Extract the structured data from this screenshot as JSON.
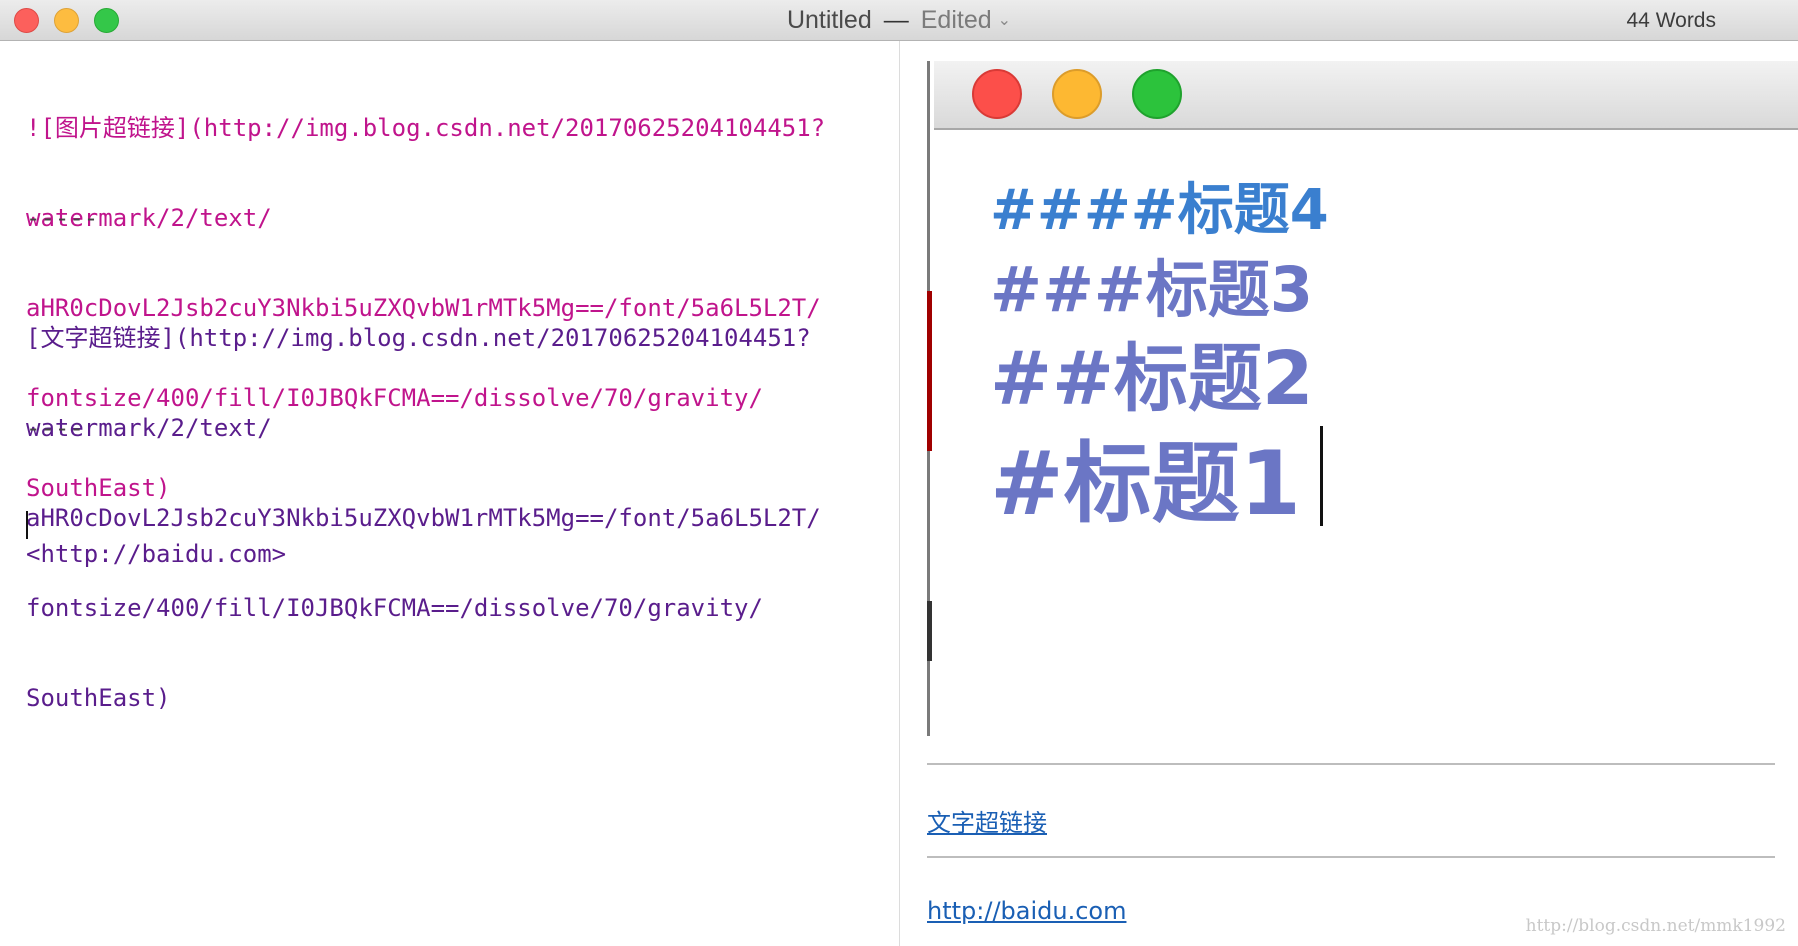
{
  "window": {
    "title": "Untitled",
    "separator": "—",
    "status": "Edited",
    "word_count": "44 Words"
  },
  "editor": {
    "image_link_lines": [
      "![图片超链接](http://img.blog.csdn.net/20170625204104451?",
      "watermark/2/text/",
      "aHR0cDovL2Jsb2cuY3Nkbi5uZXQvbW1rMTk5Mg==/font/5a6L5L2T/",
      "fontsize/400/fill/I0JBQkFCMA==/dissolve/70/gravity/",
      "SouthEast)"
    ],
    "hr_1": "-----",
    "text_link_lines": [
      "[文字超链接](http://img.blog.csdn.net/20170625204104451?",
      "watermark/2/text/",
      "aHR0cDovL2Jsb2cuY3Nkbi5uZXQvbW1rMTk5Mg==/font/5a6L5L2T/",
      "fontsize/400/fill/I0JBQkFCMA==/dissolve/70/gravity/",
      "SouthEast)"
    ],
    "hr_2": "----",
    "autolink": "<http://baidu.com>"
  },
  "preview": {
    "embedded_image": {
      "h4": "####标题4",
      "h3": "###标题3",
      "h2": "##标题2",
      "h1": "#标题1"
    },
    "text_link": "文字超链接",
    "autolink": "http://baidu.com",
    "watermark": "http://blog.csdn.net/mmk1992"
  },
  "colors": {
    "markdown_image_syntax": "#c0148c",
    "markdown_link_syntax": "#5a1d8c",
    "preview_link": "#1a5fb4",
    "heading": "#6b76c5"
  }
}
